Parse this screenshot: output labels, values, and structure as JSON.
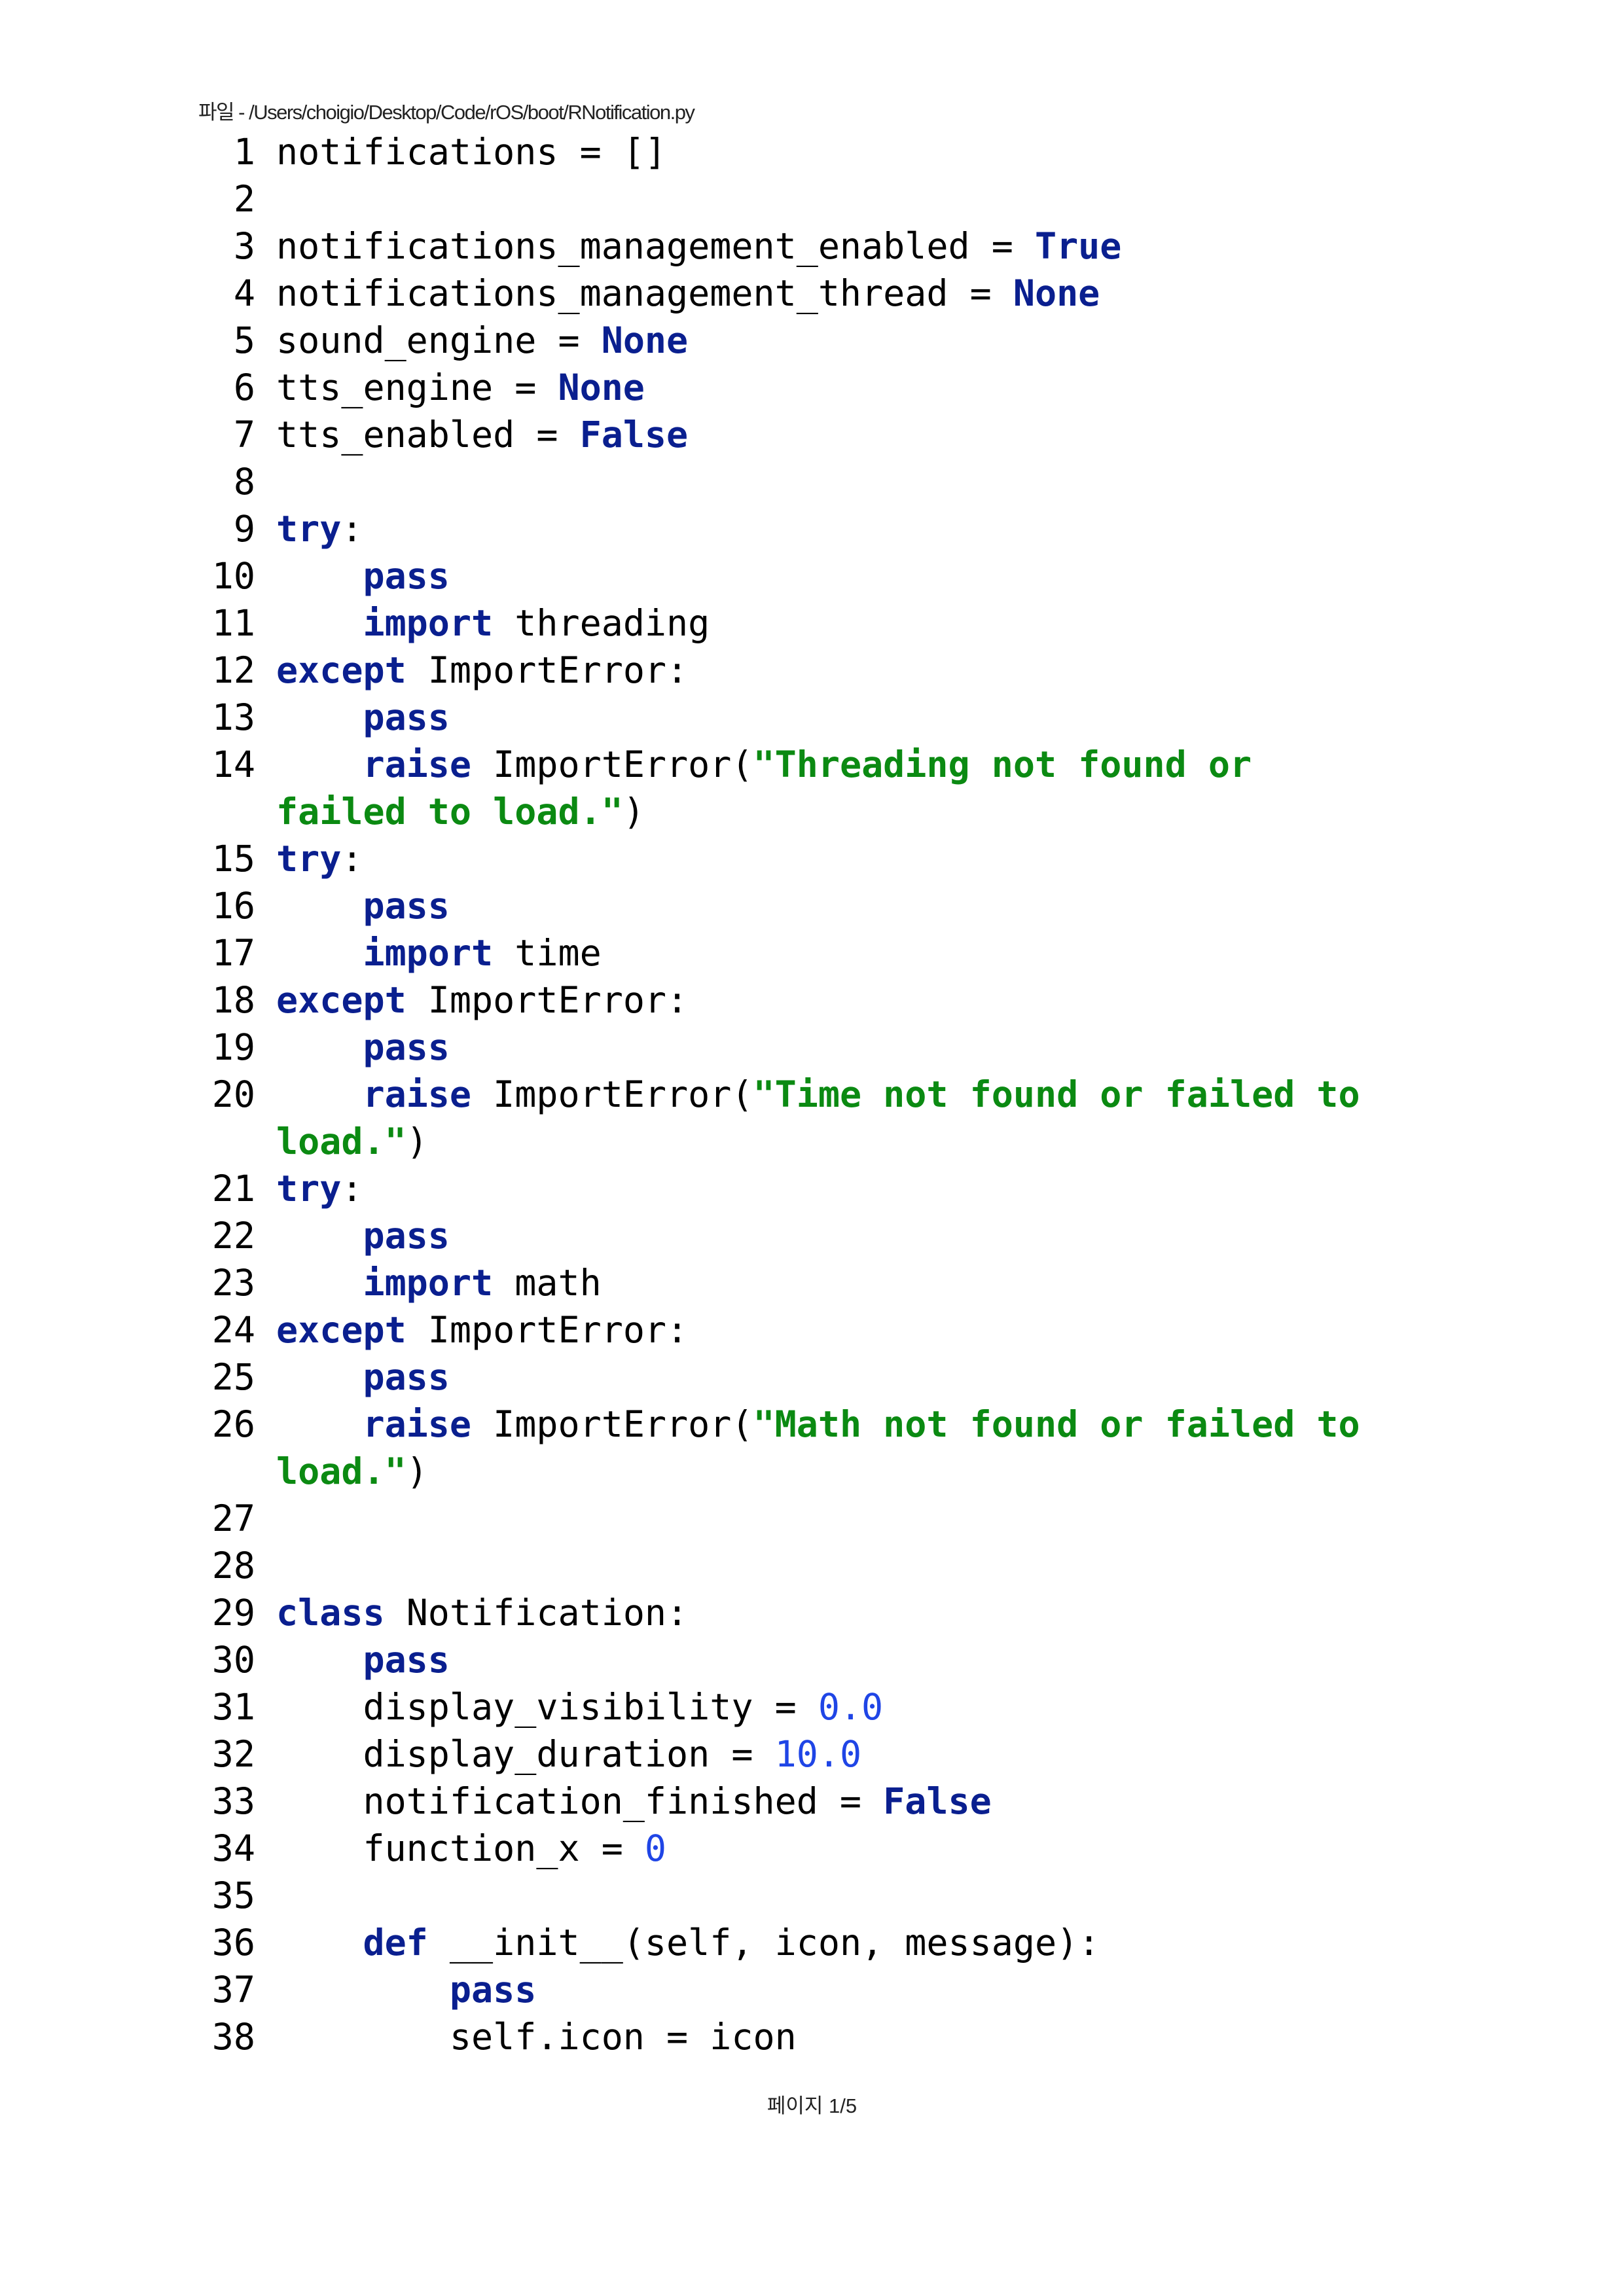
{
  "header": "파일 - /Users/choigio/Desktop/Code/rOS/boot/RNotification.py",
  "footer": "페이지 1/5",
  "colors": {
    "keyword": "#0a1f8f",
    "string": "#0b8a12",
    "number": "#1f45e6"
  },
  "rows": [
    {
      "n": "1",
      "t": [
        [
          "t",
          "notifications = []"
        ]
      ]
    },
    {
      "n": "2",
      "t": []
    },
    {
      "n": "3",
      "t": [
        [
          "t",
          "notifications_management_enabled = "
        ],
        [
          "k",
          "True"
        ]
      ]
    },
    {
      "n": "4",
      "t": [
        [
          "t",
          "notifications_management_thread = "
        ],
        [
          "k",
          "None"
        ]
      ]
    },
    {
      "n": "5",
      "t": [
        [
          "t",
          "sound_engine = "
        ],
        [
          "k",
          "None"
        ]
      ]
    },
    {
      "n": "6",
      "t": [
        [
          "t",
          "tts_engine = "
        ],
        [
          "k",
          "None"
        ]
      ]
    },
    {
      "n": "7",
      "t": [
        [
          "t",
          "tts_enabled = "
        ],
        [
          "k",
          "False"
        ]
      ]
    },
    {
      "n": "8",
      "t": []
    },
    {
      "n": "9",
      "t": [
        [
          "k",
          "try"
        ],
        [
          "t",
          ":"
        ]
      ]
    },
    {
      "n": "10",
      "t": [
        [
          "t",
          "    "
        ],
        [
          "k",
          "pass"
        ]
      ]
    },
    {
      "n": "11",
      "t": [
        [
          "t",
          "    "
        ],
        [
          "k",
          "import"
        ],
        [
          "t",
          " threading"
        ]
      ]
    },
    {
      "n": "12",
      "t": [
        [
          "k",
          "except"
        ],
        [
          "t",
          " ImportError:"
        ]
      ]
    },
    {
      "n": "13",
      "t": [
        [
          "t",
          "    "
        ],
        [
          "k",
          "pass"
        ]
      ]
    },
    {
      "n": "14",
      "t": [
        [
          "t",
          "    "
        ],
        [
          "k",
          "raise"
        ],
        [
          "t",
          " ImportError("
        ],
        [
          "s",
          "\"Threading not found or"
        ]
      ]
    },
    {
      "n": "",
      "t": [
        [
          "s",
          "failed to load.\""
        ],
        [
          "t",
          ")"
        ]
      ]
    },
    {
      "n": "15",
      "t": [
        [
          "k",
          "try"
        ],
        [
          "t",
          ":"
        ]
      ]
    },
    {
      "n": "16",
      "t": [
        [
          "t",
          "    "
        ],
        [
          "k",
          "pass"
        ]
      ]
    },
    {
      "n": "17",
      "t": [
        [
          "t",
          "    "
        ],
        [
          "k",
          "import"
        ],
        [
          "t",
          " time"
        ]
      ]
    },
    {
      "n": "18",
      "t": [
        [
          "k",
          "except"
        ],
        [
          "t",
          " ImportError:"
        ]
      ]
    },
    {
      "n": "19",
      "t": [
        [
          "t",
          "    "
        ],
        [
          "k",
          "pass"
        ]
      ]
    },
    {
      "n": "20",
      "t": [
        [
          "t",
          "    "
        ],
        [
          "k",
          "raise"
        ],
        [
          "t",
          " ImportError("
        ],
        [
          "s",
          "\"Time not found or failed to"
        ]
      ]
    },
    {
      "n": "",
      "t": [
        [
          "s",
          "load.\""
        ],
        [
          "t",
          ")"
        ]
      ]
    },
    {
      "n": "21",
      "t": [
        [
          "k",
          "try"
        ],
        [
          "t",
          ":"
        ]
      ]
    },
    {
      "n": "22",
      "t": [
        [
          "t",
          "    "
        ],
        [
          "k",
          "pass"
        ]
      ]
    },
    {
      "n": "23",
      "t": [
        [
          "t",
          "    "
        ],
        [
          "k",
          "import"
        ],
        [
          "t",
          " math"
        ]
      ]
    },
    {
      "n": "24",
      "t": [
        [
          "k",
          "except"
        ],
        [
          "t",
          " ImportError:"
        ]
      ]
    },
    {
      "n": "25",
      "t": [
        [
          "t",
          "    "
        ],
        [
          "k",
          "pass"
        ]
      ]
    },
    {
      "n": "26",
      "t": [
        [
          "t",
          "    "
        ],
        [
          "k",
          "raise"
        ],
        [
          "t",
          " ImportError("
        ],
        [
          "s",
          "\"Math not found or failed to"
        ]
      ]
    },
    {
      "n": "",
      "t": [
        [
          "s",
          "load.\""
        ],
        [
          "t",
          ")"
        ]
      ]
    },
    {
      "n": "27",
      "t": []
    },
    {
      "n": "28",
      "t": []
    },
    {
      "n": "29",
      "t": [
        [
          "k",
          "class"
        ],
        [
          "t",
          " Notification:"
        ]
      ]
    },
    {
      "n": "30",
      "t": [
        [
          "t",
          "    "
        ],
        [
          "k",
          "pass"
        ]
      ]
    },
    {
      "n": "31",
      "t": [
        [
          "t",
          "    display_visibility = "
        ],
        [
          "n",
          "0.0"
        ]
      ]
    },
    {
      "n": "32",
      "t": [
        [
          "t",
          "    display_duration = "
        ],
        [
          "n",
          "10.0"
        ]
      ]
    },
    {
      "n": "33",
      "t": [
        [
          "t",
          "    notification_finished = "
        ],
        [
          "k",
          "False"
        ]
      ]
    },
    {
      "n": "34",
      "t": [
        [
          "t",
          "    function_x = "
        ],
        [
          "n",
          "0"
        ]
      ]
    },
    {
      "n": "35",
      "t": []
    },
    {
      "n": "36",
      "t": [
        [
          "t",
          "    "
        ],
        [
          "k",
          "def"
        ],
        [
          "t",
          " __init__(self, icon, message):"
        ]
      ]
    },
    {
      "n": "37",
      "t": [
        [
          "t",
          "        "
        ],
        [
          "k",
          "pass"
        ]
      ]
    },
    {
      "n": "38",
      "t": [
        [
          "t",
          "        self.icon = icon"
        ]
      ]
    }
  ]
}
